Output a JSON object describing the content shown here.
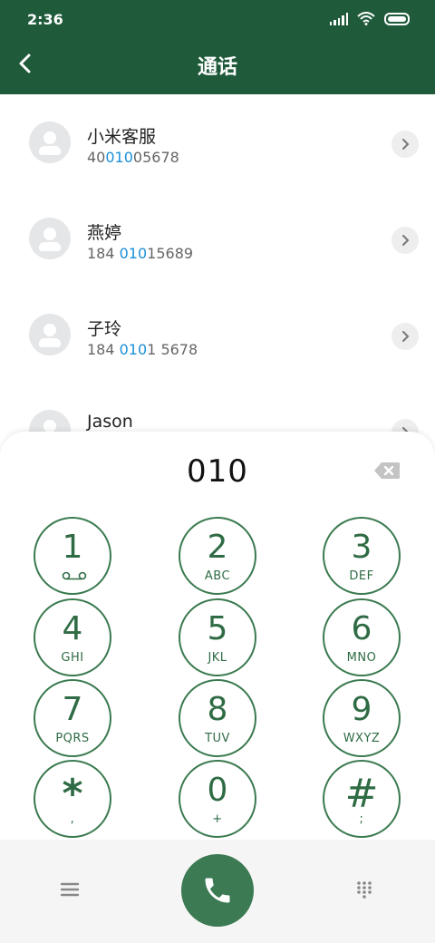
{
  "status": {
    "time": "2:36"
  },
  "header": {
    "title": "通话"
  },
  "contacts": [
    {
      "name": "小米客服",
      "number_pre": "40",
      "number_hl": "010",
      "number_post": "05678"
    },
    {
      "name": "燕婷",
      "number_pre": "184 ",
      "number_hl": "010",
      "number_post": "15689"
    },
    {
      "name": "子玲",
      "number_pre": "184 ",
      "number_hl": "010",
      "number_post": "1 5678"
    },
    {
      "name": "Jason",
      "number_pre": "",
      "number_hl": "",
      "number_post": ""
    }
  ],
  "dialpad": {
    "input": "010",
    "keys": [
      {
        "digit": "1",
        "letters": ""
      },
      {
        "digit": "2",
        "letters": "ABC"
      },
      {
        "digit": "3",
        "letters": "DEF"
      },
      {
        "digit": "4",
        "letters": "GHI"
      },
      {
        "digit": "5",
        "letters": "JKL"
      },
      {
        "digit": "6",
        "letters": "MNO"
      },
      {
        "digit": "7",
        "letters": "PQRS"
      },
      {
        "digit": "8",
        "letters": "TUV"
      },
      {
        "digit": "9",
        "letters": "WXYZ"
      },
      {
        "digit": "*",
        "letters": ","
      },
      {
        "digit": "0",
        "letters": "+"
      },
      {
        "digit": "#",
        "letters": ";"
      }
    ]
  },
  "colors": {
    "header_bg": "#1f5a3a",
    "accent_green": "#3b7a52",
    "highlight_blue": "#1a8fd9"
  },
  "icons": {
    "back": "chevron-left-icon",
    "backspace": "backspace-icon",
    "menu": "menu-icon",
    "call": "phone-icon",
    "dialpad": "dialpad-grid-icon",
    "voicemail": "voicemail-icon"
  }
}
